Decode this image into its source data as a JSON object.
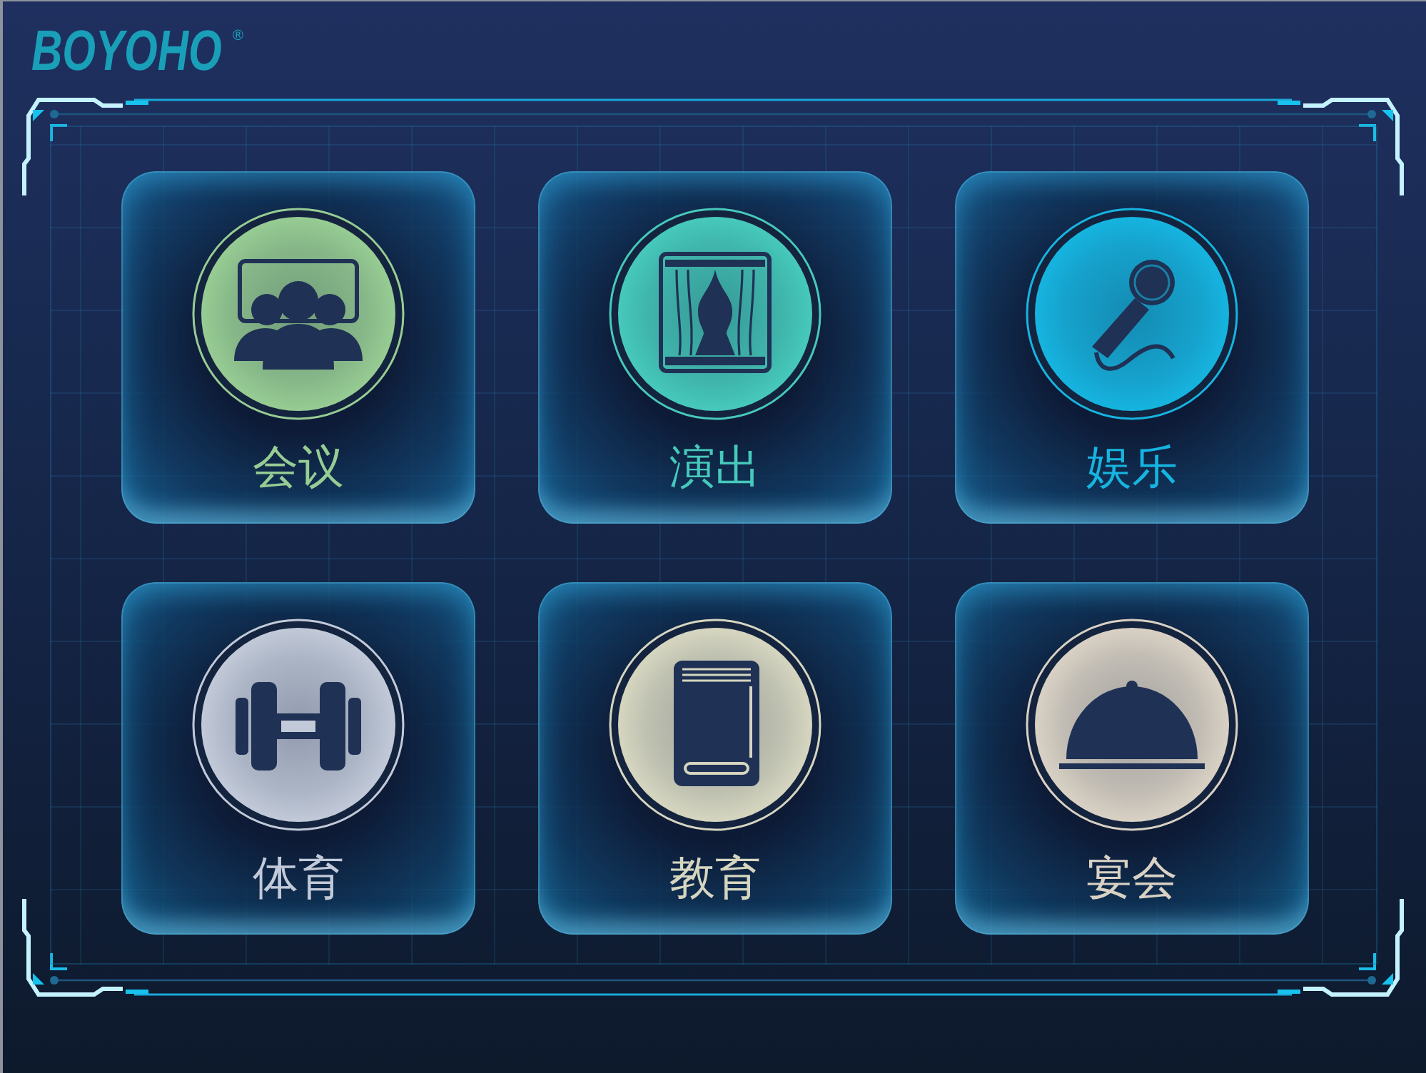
{
  "logo": {
    "text": "BOYOHO",
    "registered_mark": "®"
  },
  "tiles": [
    {
      "label": "会议",
      "kind": "audience",
      "color": "#97cc93"
    },
    {
      "label": "演出",
      "kind": "stage",
      "color": "#46c9bb"
    },
    {
      "label": "娱乐",
      "kind": "microphone",
      "color": "#16b4e0"
    },
    {
      "label": "体育",
      "kind": "dumbbell",
      "color": "#c2cad9"
    },
    {
      "label": "教育",
      "kind": "book",
      "color": "#d6d6c0"
    },
    {
      "label": "宴会",
      "kind": "cloche",
      "color": "#d9d1c4"
    }
  ]
}
